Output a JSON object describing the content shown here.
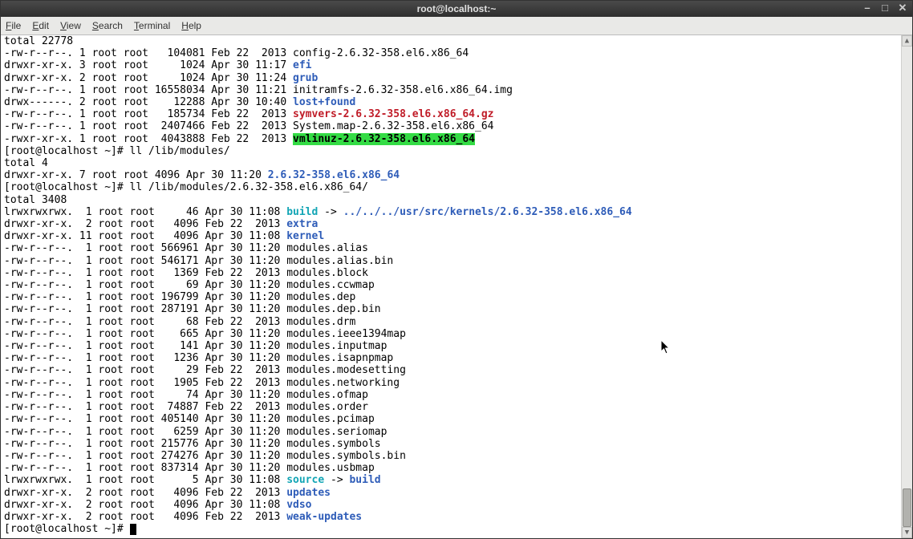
{
  "window": {
    "title": "root@localhost:~"
  },
  "menu": {
    "file": "File",
    "edit": "Edit",
    "view": "View",
    "search": "Search",
    "terminal": "Terminal",
    "help": "Help"
  },
  "lines": {
    "total1": "total 22778",
    "l1a": "-rw-r--r--. 1 root root   104081 Feb 22  2013 config-2.6.32-358.el6.x86_64",
    "l2a": "drwxr-xr-x. 3 root root     1024 Apr 30 11:17 ",
    "l2b": "efi",
    "l3a": "drwxr-xr-x. 2 root root     1024 Apr 30 11:24 ",
    "l3b": "grub",
    "l4a": "-rw-r--r--. 1 root root 16558034 Apr 30 11:21 initramfs-2.6.32-358.el6.x86_64.img",
    "l5a": "drwx------. 2 root root    12288 Apr 30 10:40 ",
    "l5b": "lost+found",
    "l6a": "-rw-r--r--. 1 root root   185734 Feb 22  2013 ",
    "l6b": "symvers-2.6.32-358.el6.x86_64.gz",
    "l7a": "-rw-r--r--. 1 root root  2407466 Feb 22  2013 System.map-2.6.32-358.el6.x86_64",
    "l8a": "-rwxr-xr-x. 1 root root  4043888 Feb 22  2013 ",
    "l8b": "vmlinuz-2.6.32-358.el6.x86_64",
    "p1": "[root@localhost ~]# ll /lib/modules/",
    "total2": "total 4",
    "l9a": "drwxr-xr-x. 7 root root 4096 Apr 30 11:20 ",
    "l9b": "2.6.32-358.el6.x86_64",
    "p2": "[root@localhost ~]# ll /lib/modules/2.6.32-358.el6.x86_64/",
    "total3": "total 3408",
    "m1a": "lrwxrwxrwx.  1 root root     46 Apr 30 11:08 ",
    "m1b": "build",
    "m1c": " -> ",
    "m1d": "../../../usr/src/kernels/2.6.32-358.el6.x86_64",
    "m2a": "drwxr-xr-x.  2 root root   4096 Feb 22  2013 ",
    "m2b": "extra",
    "m3a": "drwxr-xr-x. 11 root root   4096 Apr 30 11:08 ",
    "m3b": "kernel",
    "m4": "-rw-r--r--.  1 root root 566961 Apr 30 11:20 modules.alias",
    "m5": "-rw-r--r--.  1 root root 546171 Apr 30 11:20 modules.alias.bin",
    "m6": "-rw-r--r--.  1 root root   1369 Feb 22  2013 modules.block",
    "m7": "-rw-r--r--.  1 root root     69 Apr 30 11:20 modules.ccwmap",
    "m8": "-rw-r--r--.  1 root root 196799 Apr 30 11:20 modules.dep",
    "m9": "-rw-r--r--.  1 root root 287191 Apr 30 11:20 modules.dep.bin",
    "m10": "-rw-r--r--.  1 root root     68 Feb 22  2013 modules.drm",
    "m11": "-rw-r--r--.  1 root root    665 Apr 30 11:20 modules.ieee1394map",
    "m12": "-rw-r--r--.  1 root root    141 Apr 30 11:20 modules.inputmap",
    "m13": "-rw-r--r--.  1 root root   1236 Apr 30 11:20 modules.isapnpmap",
    "m14": "-rw-r--r--.  1 root root     29 Feb 22  2013 modules.modesetting",
    "m15": "-rw-r--r--.  1 root root   1905 Feb 22  2013 modules.networking",
    "m16": "-rw-r--r--.  1 root root     74 Apr 30 11:20 modules.ofmap",
    "m17": "-rw-r--r--.  1 root root  74887 Feb 22  2013 modules.order",
    "m18": "-rw-r--r--.  1 root root 405140 Apr 30 11:20 modules.pcimap",
    "m19": "-rw-r--r--.  1 root root   6259 Apr 30 11:20 modules.seriomap",
    "m20": "-rw-r--r--.  1 root root 215776 Apr 30 11:20 modules.symbols",
    "m21": "-rw-r--r--.  1 root root 274276 Apr 30 11:20 modules.symbols.bin",
    "m22": "-rw-r--r--.  1 root root 837314 Apr 30 11:20 modules.usbmap",
    "m23a": "lrwxrwxrwx.  1 root root      5 Apr 30 11:08 ",
    "m23b": "source",
    "m23c": " -> ",
    "m23d": "build",
    "m24a": "drwxr-xr-x.  2 root root   4096 Feb 22  2013 ",
    "m24b": "updates",
    "m25a": "drwxr-xr-x.  2 root root   4096 Apr 30 11:08 ",
    "m25b": "vdso",
    "m26a": "drwxr-xr-x.  2 root root   4096 Feb 22  2013 ",
    "m26b": "weak-updates",
    "p3": "[root@localhost ~]# "
  }
}
